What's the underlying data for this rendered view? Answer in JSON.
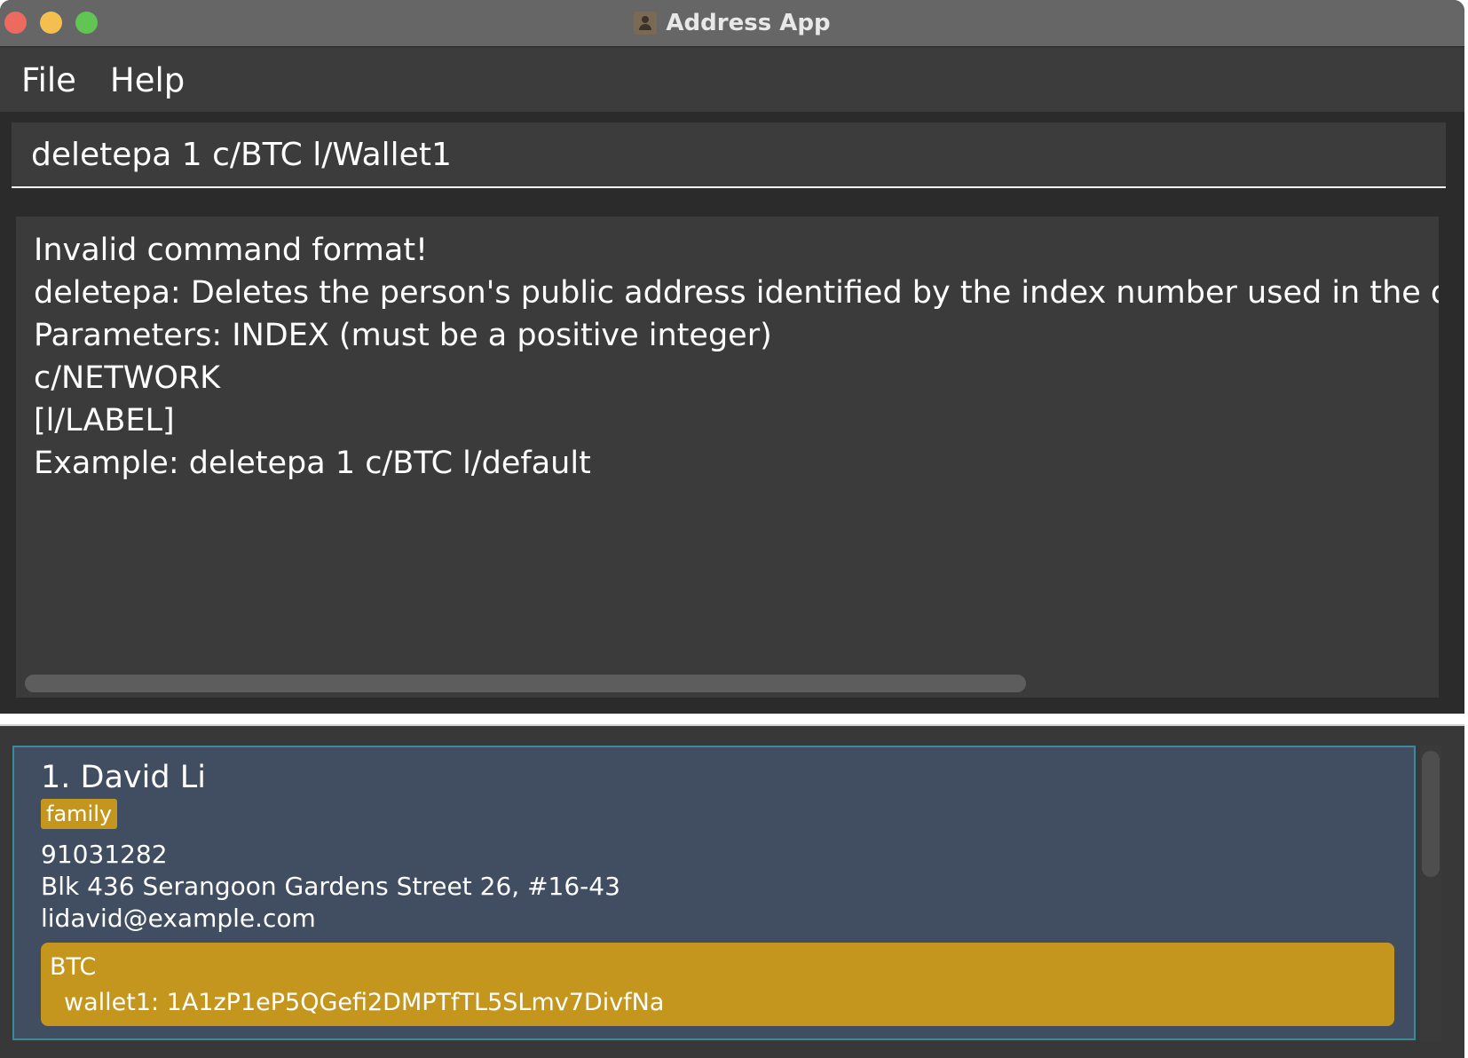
{
  "window": {
    "title": "Address App",
    "controls": [
      "close",
      "minimize",
      "maximize"
    ],
    "app_icon": "contact-card-icon"
  },
  "menu": {
    "items": [
      {
        "label": "File"
      },
      {
        "label": "Help"
      }
    ]
  },
  "command_box": {
    "value": "deletepa 1 c/BTC l/Wallet1"
  },
  "result_display": {
    "lines": [
      "Invalid command format!",
      "deletepa: Deletes the person's public address identified by the index number used in the displaye",
      "Parameters: INDEX (must be a positive integer)",
      "c/NETWORK",
      "[l/LABEL]",
      "Example: deletepa 1 c/BTC l/default"
    ]
  },
  "person_list": {
    "persons": [
      {
        "index_name": "1. David Li",
        "tag": "family",
        "phone": "91031282",
        "address": "Blk 436 Serangoon Gardens Street 26, #16-43",
        "email": "lidavid@example.com",
        "wallet": {
          "network": "BTC",
          "entry": "wallet1: 1A1zP1eP5QGefi2DMPTfTL5SLmv7DivfNa"
        }
      }
    ]
  },
  "colors": {
    "card_background": "#414d61",
    "tag_background": "#c4961e",
    "window_background": "#383838"
  }
}
